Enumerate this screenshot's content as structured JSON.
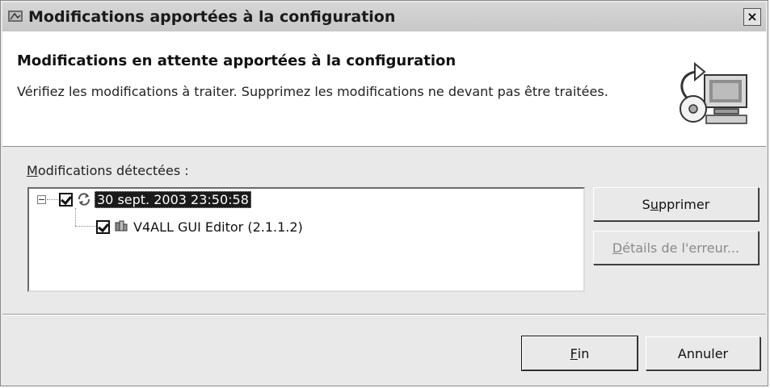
{
  "window": {
    "title": "Modifications apportées à la configuration",
    "close_glyph": "×"
  },
  "header": {
    "title": "Modifications en attente apportées à la configuration",
    "description": "Vérifiez les modifications à traiter. Supprimez les modifications ne devant pas être traitées."
  },
  "detected": {
    "label_mnemonic": "M",
    "label_rest": "odifications détectées :"
  },
  "tree": {
    "items": [
      {
        "label": "30 sept. 2003 23:50:58",
        "checked": true,
        "expanded": true,
        "icon": "sync-icon",
        "selected": true
      },
      {
        "label": "V4ALL GUI Editor (2.1.1.2)",
        "checked": true,
        "icon": "feature-icon",
        "selected": false
      }
    ]
  },
  "buttons": {
    "remove_pre": "S",
    "remove_mn": "u",
    "remove_post": "pprimer",
    "details_mn": "D",
    "details_post": "étails de l'erreur...",
    "finish_mn": "F",
    "finish_post": "in",
    "cancel": "Annuler"
  }
}
